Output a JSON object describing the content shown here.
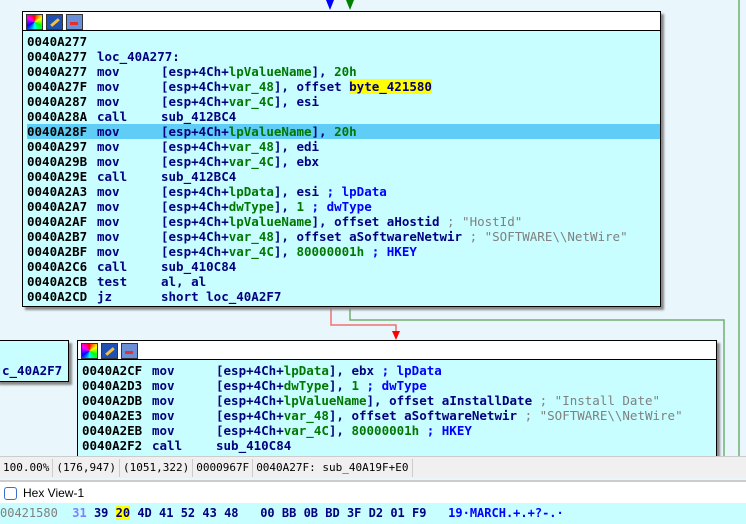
{
  "block1": {
    "lines": [
      {
        "addr": "0040A277",
        "mn": "",
        "ops": []
      },
      {
        "addr": "0040A277",
        "mn": "",
        "ops": [
          [
            "loc_40A277:",
            "n"
          ]
        ]
      },
      {
        "addr": "0040A277",
        "mn": "mov",
        "ops": [
          [
            "[esp+4Ch+",
            "n"
          ],
          [
            "lpValueName",
            "g"
          ],
          [
            "], ",
            "n"
          ],
          [
            "20h",
            "g"
          ]
        ]
      },
      {
        "addr": "0040A27F",
        "mn": "mov",
        "ops": [
          [
            "[esp+4Ch+",
            "n"
          ],
          [
            "var_48",
            "g"
          ],
          [
            "], offset ",
            "n"
          ],
          [
            "byte_421580",
            "y"
          ]
        ]
      },
      {
        "addr": "0040A287",
        "mn": "mov",
        "ops": [
          [
            "[esp+4Ch+",
            "n"
          ],
          [
            "var_4C",
            "g"
          ],
          [
            "], esi",
            "n"
          ]
        ]
      },
      {
        "addr": "0040A28A",
        "mn": "call",
        "ops": [
          [
            "sub_412BC4",
            "n"
          ]
        ]
      },
      {
        "addr": "0040A28F",
        "mn": "mov",
        "ops": [
          [
            "[esp+4Ch+",
            "n"
          ],
          [
            "lpValueName",
            "g"
          ],
          [
            "], ",
            "n"
          ],
          [
            "20h",
            "g"
          ]
        ],
        "selected": true
      },
      {
        "addr": "0040A297",
        "mn": "mov",
        "ops": [
          [
            "[esp+4Ch+",
            "n"
          ],
          [
            "var_48",
            "g"
          ],
          [
            "], edi",
            "n"
          ]
        ]
      },
      {
        "addr": "0040A29B",
        "mn": "mov",
        "ops": [
          [
            "[esp+4Ch+",
            "n"
          ],
          [
            "var_4C",
            "g"
          ],
          [
            "], ebx",
            "n"
          ]
        ]
      },
      {
        "addr": "0040A29E",
        "mn": "call",
        "ops": [
          [
            "sub_412BC4",
            "n"
          ]
        ]
      },
      {
        "addr": "0040A2A3",
        "mn": "mov",
        "ops": [
          [
            "[esp+4Ch+",
            "n"
          ],
          [
            "lpData",
            "g"
          ],
          [
            "], esi ",
            "n"
          ],
          [
            "; lpData",
            "b"
          ]
        ]
      },
      {
        "addr": "0040A2A7",
        "mn": "mov",
        "ops": [
          [
            "[esp+4Ch+",
            "n"
          ],
          [
            "dwType",
            "g"
          ],
          [
            "], ",
            "n"
          ],
          [
            "1",
            "g"
          ],
          [
            " ; dwType",
            "b"
          ]
        ]
      },
      {
        "addr": "0040A2AF",
        "mn": "mov",
        "ops": [
          [
            "[esp+4Ch+",
            "n"
          ],
          [
            "lpValueName",
            "g"
          ],
          [
            "], offset aHostid ",
            "n"
          ],
          [
            "; \"HostId\"",
            "c"
          ]
        ]
      },
      {
        "addr": "0040A2B7",
        "mn": "mov",
        "ops": [
          [
            "[esp+4Ch+",
            "n"
          ],
          [
            "var_48",
            "g"
          ],
          [
            "], offset aSoftwareNetwir ",
            "n"
          ],
          [
            "; \"SOFTWARE\\\\NetWire\"",
            "c"
          ]
        ]
      },
      {
        "addr": "0040A2BF",
        "mn": "mov",
        "ops": [
          [
            "[esp+4Ch+",
            "n"
          ],
          [
            "var_4C",
            "g"
          ],
          [
            "], ",
            "n"
          ],
          [
            "80000001h",
            "g"
          ],
          [
            " ; HKEY",
            "b"
          ]
        ]
      },
      {
        "addr": "0040A2C6",
        "mn": "call",
        "ops": [
          [
            "sub_410C84",
            "n"
          ]
        ]
      },
      {
        "addr": "0040A2CB",
        "mn": "test",
        "ops": [
          [
            "al, al",
            "n"
          ]
        ]
      },
      {
        "addr": "0040A2CD",
        "mn": "jz",
        "ops": [
          [
            "short loc_40A2F7",
            "n"
          ]
        ]
      }
    ]
  },
  "block2": {
    "lines": [
      {
        "addr": "0040A2CF",
        "mn": "mov",
        "ops": [
          [
            "[esp+4Ch+",
            "n"
          ],
          [
            "lpData",
            "g"
          ],
          [
            "], ebx ",
            "n"
          ],
          [
            "; lpData",
            "b"
          ]
        ]
      },
      {
        "addr": "0040A2D3",
        "mn": "mov",
        "ops": [
          [
            "[esp+4Ch+",
            "n"
          ],
          [
            "dwType",
            "g"
          ],
          [
            "], ",
            "n"
          ],
          [
            "1",
            "g"
          ],
          [
            " ; dwType",
            "b"
          ]
        ]
      },
      {
        "addr": "0040A2DB",
        "mn": "mov",
        "ops": [
          [
            "[esp+4Ch+",
            "n"
          ],
          [
            "lpValueName",
            "g"
          ],
          [
            "], offset aInstallDate ",
            "n"
          ],
          [
            "; \"Install Date\"",
            "c"
          ]
        ]
      },
      {
        "addr": "0040A2E3",
        "mn": "mov",
        "ops": [
          [
            "[esp+4Ch+",
            "n"
          ],
          [
            "var_48",
            "g"
          ],
          [
            "], offset aSoftwareNetwir ",
            "n"
          ],
          [
            "; \"SOFTWARE\\\\NetWire\"",
            "c"
          ]
        ]
      },
      {
        "addr": "0040A2EB",
        "mn": "mov",
        "ops": [
          [
            "[esp+4Ch+",
            "n"
          ],
          [
            "var_4C",
            "g"
          ],
          [
            "], ",
            "n"
          ],
          [
            "80000001h",
            "g"
          ],
          [
            " ; HKEY",
            "b"
          ]
        ]
      },
      {
        "addr": "0040A2F2",
        "mn": "call",
        "ops": [
          [
            "sub_410C84",
            "n"
          ]
        ]
      }
    ]
  },
  "left_block": {
    "label": "c_40A2F7"
  },
  "status": {
    "zoom": "100.00%",
    "pos1": "(176,947)",
    "pos2": "(1051,322)",
    "offset": "0000967F",
    "location": "0040A27F: sub_40A19F+E0"
  },
  "hex_view": {
    "title": "Hex View-1",
    "addr": "00421580",
    "bytes": [
      "31",
      "39",
      "20",
      "4D",
      "41",
      "52",
      "43",
      "48",
      "00",
      "BB",
      "0B",
      "BD",
      "3F",
      "D2",
      "01",
      "F9"
    ],
    "ascii": "19·MARCH.+.+?-.·"
  }
}
